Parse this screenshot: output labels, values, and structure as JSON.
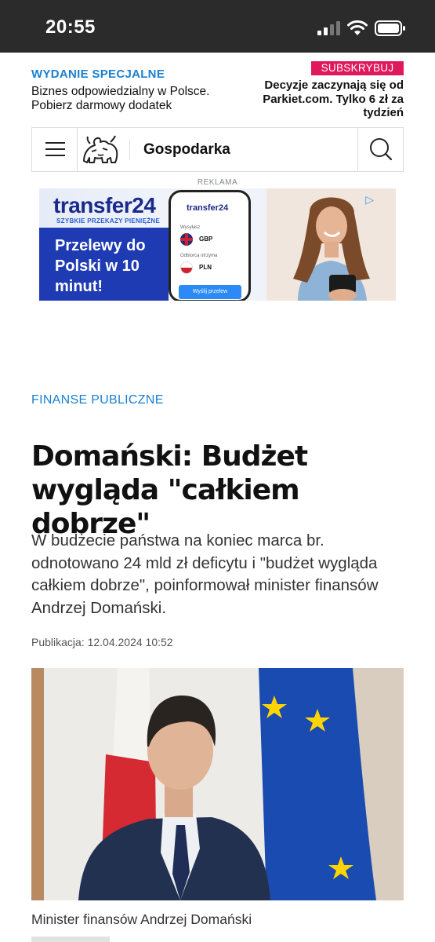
{
  "status_bar": {
    "time": "20:55"
  },
  "promo": {
    "special_label": "WYDANIE SPECJALNE",
    "special_text": "Biznes odpowiedzialny w Polsce. Pobierz darmowy dodatek",
    "subscribe_label": "SUBSKRYBUJ",
    "subscribe_text": "Decyzje zaczynają się od Parkiet.com. Tylko 6 zł za tydzień"
  },
  "nav": {
    "section": "Gospodarka"
  },
  "ad": {
    "label": "REKLAMA",
    "brand": "transfer24",
    "tagline": "SZYBKIE PRZEKAZY PIENIĘŻNE",
    "headline": "Przelewy do Polski w 10 minut!",
    "phone_brand": "transfer24",
    "sender_label": "Wysyłasz",
    "sender_currency": "GBP",
    "receiver_label": "Odbiorca otrzyma",
    "receiver_currency": "PLN",
    "send_button": "Wyślij przelew"
  },
  "article": {
    "category": "FINANSE PUBLICZNE",
    "title": "Domański: Budżet wygląda \"całkiem dobrze\"",
    "lead": "W budżecie państwa na koniec marca br. odnotowano 24 mld zł deficytu i \"budżet wygląda całkiem dobrze\", poinformował minister finansów Andrzej Domański.",
    "published": "Publikacja: 12.04.2024 10:52",
    "photo_caption": "Minister finansów Andrzej Domański"
  },
  "colors": {
    "accent_blue": "#1a7fd1",
    "subscribe_pink": "#e0185c"
  }
}
